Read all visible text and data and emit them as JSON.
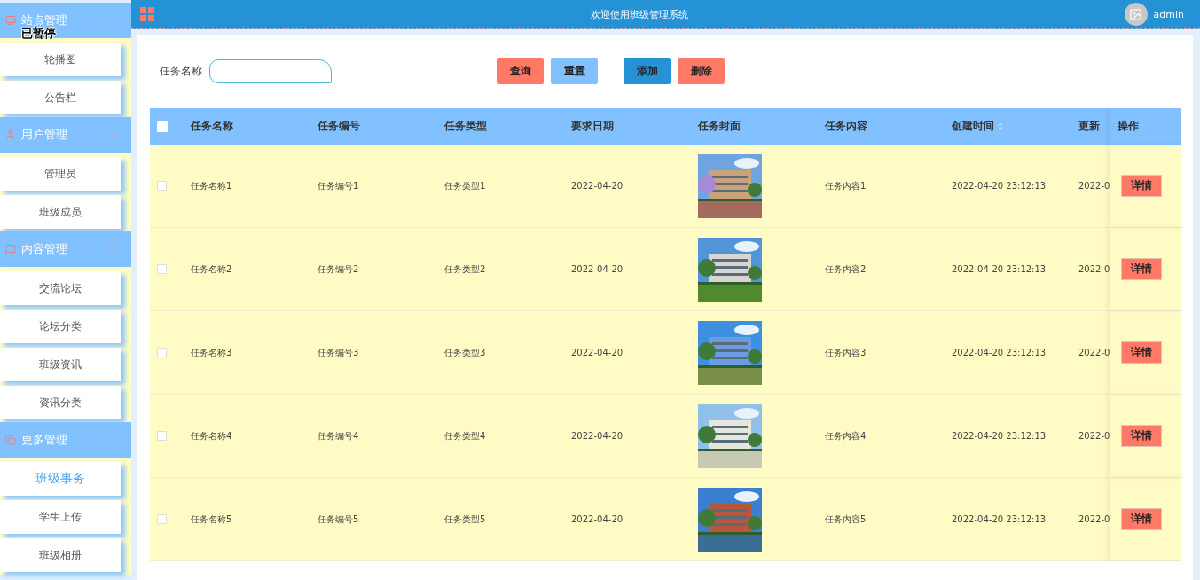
{
  "overlay_label": "已暂停",
  "sidebar": {
    "groups": [
      {
        "title": "站点管理",
        "expanded": true,
        "items": [
          {
            "label": "轮播图",
            "selected": false
          },
          {
            "label": "公告栏",
            "selected": false
          }
        ]
      },
      {
        "title": "用户管理",
        "expanded": true,
        "items": [
          {
            "label": "管理员",
            "selected": false
          },
          {
            "label": "班级成员",
            "selected": false
          }
        ]
      },
      {
        "title": "内容管理",
        "expanded": true,
        "items": [
          {
            "label": "交流论坛",
            "selected": false
          },
          {
            "label": "论坛分类",
            "selected": false
          },
          {
            "label": "班级资讯",
            "selected": false
          },
          {
            "label": "资讯分类",
            "selected": false
          }
        ]
      },
      {
        "title": "更多管理",
        "expanded": true,
        "items": [
          {
            "label": "班级事务",
            "selected": true
          },
          {
            "label": "学生上传",
            "selected": false
          },
          {
            "label": "班级相册",
            "selected": false
          }
        ]
      }
    ]
  },
  "top_bar": {
    "title": "欢迎使用班级管理系统",
    "user": "admin"
  },
  "search": {
    "label": "任务名称"
  },
  "buttons": [
    {
      "label": "查询",
      "kind": "danger"
    },
    {
      "label": "重置",
      "kind": "light"
    },
    {
      "label": "添加",
      "kind": "primary"
    },
    {
      "label": "删除",
      "kind": "danger"
    }
  ],
  "table": {
    "select_all_checked": false,
    "columns": [
      "任务名称",
      "任务编号",
      "任务类型",
      "要求日期",
      "任务封面",
      "任务内容",
      "创建时间",
      "更新",
      "操作"
    ],
    "rows": [
      {
        "checked": false,
        "name": "任务名称1",
        "code": "任务编号1",
        "type": "任务类型1",
        "date": "2022-04-20",
        "content": "任务内容1",
        "created": "2022-04-20 23:12:13",
        "updated": "2022-0",
        "action": "详情"
      },
      {
        "checked": false,
        "name": "任务名称2",
        "code": "任务编号2",
        "type": "任务类型2",
        "date": "2022-04-20",
        "content": "任务内容2",
        "created": "2022-04-20 23:12:13",
        "updated": "2022-0",
        "action": "详情"
      },
      {
        "checked": false,
        "name": "任务名称3",
        "code": "任务编号3",
        "type": "任务类型3",
        "date": "2022-04-20",
        "content": "任务内容3",
        "created": "2022-04-20 23:12:13",
        "updated": "2022-0",
        "action": "详情"
      },
      {
        "checked": false,
        "name": "任务名称4",
        "code": "任务编号4",
        "type": "任务类型4",
        "date": "2022-04-20",
        "content": "任务内容4",
        "created": "2022-04-20 23:12:13",
        "updated": "2022-0",
        "action": "详情"
      },
      {
        "checked": false,
        "name": "任务名称5",
        "code": "任务编号5",
        "type": "任务类型5",
        "date": "2022-04-20",
        "content": "任务内容5",
        "created": "2022-04-20 23:12:13",
        "updated": "2022-0",
        "action": "详情"
      }
    ]
  }
}
